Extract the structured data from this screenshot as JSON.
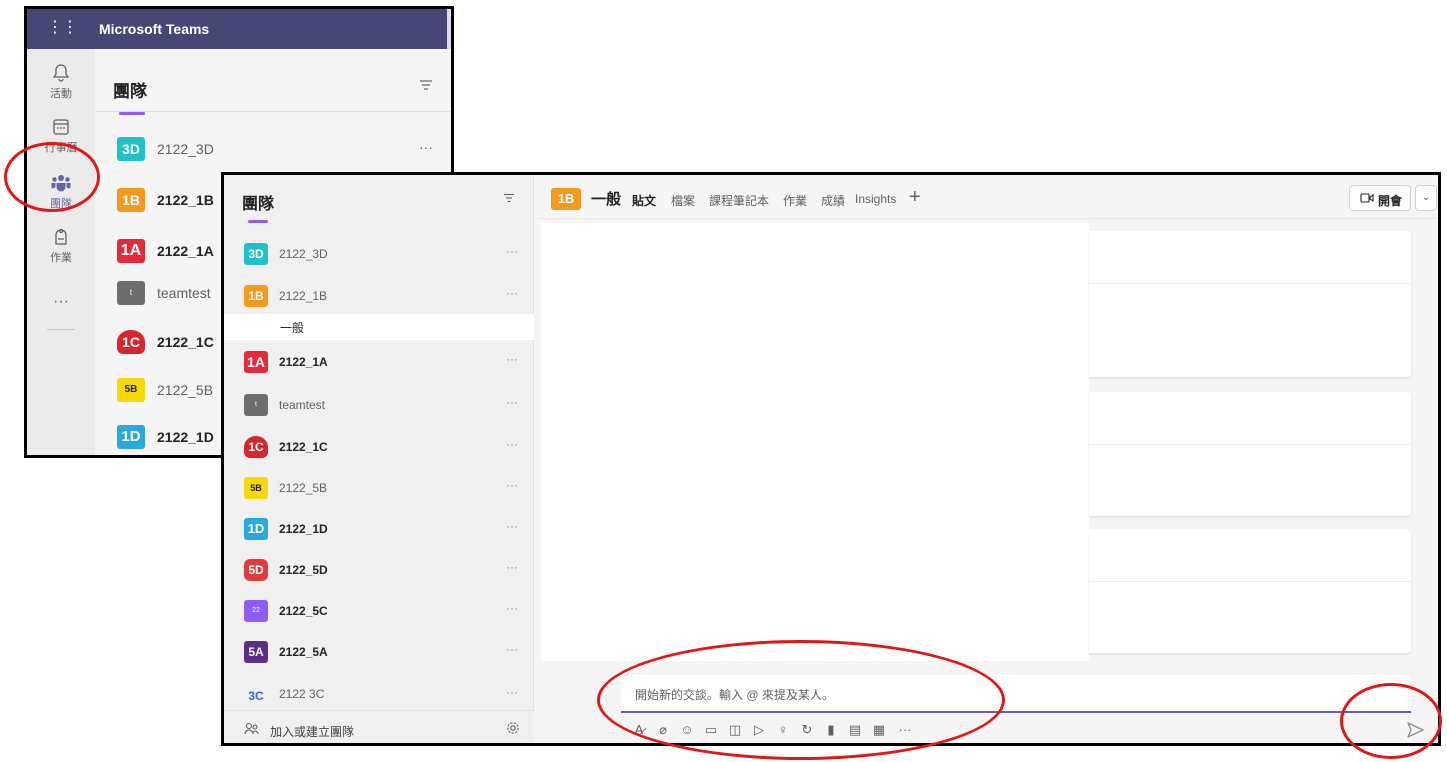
{
  "back_window": {
    "app_title": "Microsoft Teams",
    "rail": [
      {
        "label": "活動",
        "icon": "bell-icon"
      },
      {
        "label": "行事曆",
        "icon": "calendar-icon"
      },
      {
        "label": "團隊",
        "icon": "teams-icon",
        "active": true
      },
      {
        "label": "作業",
        "icon": "assignments-icon"
      }
    ],
    "rail_more": "···",
    "list_header": "團隊",
    "teams": [
      {
        "avatar": "3D",
        "name": "2122_3D",
        "color": "#21c1c9",
        "bold": false,
        "more": "···"
      },
      {
        "avatar": "1B",
        "name": "2122_1B",
        "color": "#f59a1d",
        "bold": true
      },
      {
        "avatar": "1A",
        "name": "2122_1A",
        "color": "#e52b3b",
        "bold": true
      },
      {
        "avatar": "t",
        "name": "teamtest",
        "color": "#6e6e6e",
        "bold": false
      },
      {
        "avatar": "1C",
        "name": "2122_1C",
        "color": "#d7262e",
        "bold": true
      },
      {
        "avatar": "5B",
        "name": "2122_5B",
        "color": "#f5d90a",
        "bold": false
      },
      {
        "avatar": "1D",
        "name": "2122_1D",
        "color": "#2aa8e0",
        "bold": true
      }
    ]
  },
  "front_window": {
    "list_header": "團隊",
    "teams": [
      {
        "avatar": "3D",
        "name": "2122_3D",
        "color": "#21c1c9",
        "bold": false
      },
      {
        "avatar": "1B",
        "name": "2122_1B",
        "color": "#f59a1d",
        "bold": false,
        "channel": "一般"
      },
      {
        "avatar": "1A",
        "name": "2122_1A",
        "color": "#e52b3b",
        "bold": true
      },
      {
        "avatar": "t",
        "name": "teamtest",
        "color": "#6e6e6e",
        "bold": false
      },
      {
        "avatar": "1C",
        "name": "2122_1C",
        "color": "#d7262e",
        "bold": true
      },
      {
        "avatar": "5B",
        "name": "2122_5B",
        "color": "#f5d90a",
        "bold": false
      },
      {
        "avatar": "1D",
        "name": "2122_1D",
        "color": "#2aa8e0",
        "bold": true
      },
      {
        "avatar": "5D",
        "name": "2122_5D",
        "color": "#e23b3b",
        "bold": true
      },
      {
        "avatar": "22",
        "name": "2122_5C",
        "color": "#8b5cf6",
        "bold": true
      },
      {
        "avatar": "5A",
        "name": "2122_5A",
        "color": "#5b2d86",
        "bold": true
      },
      {
        "avatar": "3C",
        "name": "2122 3C",
        "color": "#2a6fd6",
        "bold": false
      }
    ],
    "more": "···",
    "join_label": "加入或建立團隊",
    "channel": {
      "avatar": "1B",
      "avatar_color": "#f59a1d",
      "name": "一般",
      "tabs": [
        "貼文",
        "檔案",
        "課程筆記本",
        "作業",
        "成績",
        "Insights"
      ],
      "add_tab": "+"
    },
    "meet_label": "開會",
    "meet_dropdown": "⌄",
    "composer_placeholder": "開始新的交談。輸入 @ 來提及某人。",
    "toolbar_icons": [
      "format-icon",
      "attach-icon",
      "emoji-icon",
      "gif-icon",
      "sticker-icon",
      "meet-now-icon",
      "praise-icon",
      "loop-icon",
      "stream-icon",
      "forms-icon",
      "onenote-icon",
      "more-icon"
    ],
    "toolbar_glyphs": [
      "A̷",
      "⌀",
      "☺",
      "▭",
      "◫",
      "▷",
      "♀",
      "↻",
      "▮",
      "▤",
      "▦",
      "···"
    ]
  },
  "colors": {
    "teams_purple": "#464775",
    "accent": "#6264a7",
    "annotation_red": "#e01818"
  }
}
